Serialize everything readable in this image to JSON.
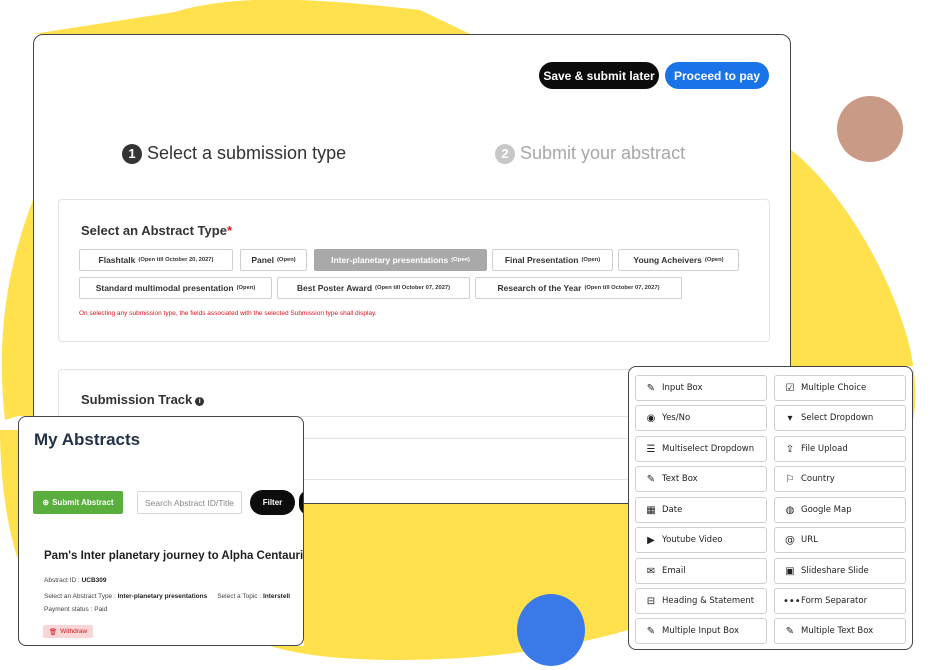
{
  "colors": {
    "yellow": "#ffe04d",
    "accent_blue": "#1a73e8",
    "dark": "#0c0c0c",
    "green": "#5aae3e",
    "error": "#d9141c"
  },
  "header": {
    "save_label": "Save & submit later",
    "proceed_label": "Proceed to pay"
  },
  "steps": [
    {
      "num": "1",
      "label": "Select a submission type"
    },
    {
      "num": "2",
      "label": "Submit your abstract"
    }
  ],
  "abstract_type": {
    "title": "Select an Abstract Type",
    "required_mark": "*",
    "options": [
      {
        "label": "Flashtalk",
        "status": "(Open till October 20, 2027)"
      },
      {
        "label": "Panel",
        "status": "(Open)"
      },
      {
        "label": "Inter-planetary presentations",
        "status": "(Open)"
      },
      {
        "label": "Final Presentation",
        "status": "(Open)"
      },
      {
        "label": "Young Acheivers",
        "status": "(Open)"
      },
      {
        "label": "Standard multimodal presentation",
        "status": "(Open)"
      },
      {
        "label": "Best Poster Award",
        "status": "(Open till October 07, 2027)"
      },
      {
        "label": "Research of the Year",
        "status": "(Open till October 07, 2027)"
      }
    ],
    "selected": "Inter-planetary presentations",
    "warning": "On selecting any submission type, the fields associated with the selected Submission type shall display."
  },
  "track": {
    "title": "Submission Track",
    "info_icon": "i"
  },
  "my_abstracts": {
    "title": "My Abstracts",
    "submit_label": "Submit Abstract",
    "search_placeholder": "Search Abstract ID/Title",
    "filter_label": "Filter",
    "item": {
      "title": "Pam's Inter planetary journey to Alpha Centauri",
      "id_label": "Abstract ID :",
      "id_value": "UCB309",
      "type_label": "Select an Abstract Type :",
      "type_value": "Inter-planetary presentations",
      "topic_label": "Select a Topic :",
      "topic_value": "Interstell",
      "payment_label": "Payment status :",
      "payment_value": "Paid",
      "withdraw_label": "Withdraw"
    }
  },
  "field_types": [
    {
      "label": "Input Box",
      "icon": "edit-icon"
    },
    {
      "label": "Multiple Choice",
      "icon": "checkbox-icon"
    },
    {
      "label": "Yes/No",
      "icon": "radio-icon"
    },
    {
      "label": "Select Dropdown",
      "icon": "caret-down-icon"
    },
    {
      "label": "Multiselect Dropdown",
      "icon": "list-icon"
    },
    {
      "label": "File Upload",
      "icon": "upload-icon"
    },
    {
      "label": "Text Box",
      "icon": "edit-icon"
    },
    {
      "label": "Country",
      "icon": "flag-icon"
    },
    {
      "label": "Date",
      "icon": "calendar-icon"
    },
    {
      "label": "Google Map",
      "icon": "globe-icon"
    },
    {
      "label": "Youtube Video",
      "icon": "youtube-icon"
    },
    {
      "label": "URL",
      "icon": "at-icon"
    },
    {
      "label": "Email",
      "icon": "envelope-icon"
    },
    {
      "label": "Slideshare Slide",
      "icon": "slideshare-icon"
    },
    {
      "label": "Heading & Statement",
      "icon": "heading-icon"
    },
    {
      "label": "Form Separator",
      "icon": "ellipsis-icon"
    },
    {
      "label": "Multiple Input Box",
      "icon": "edit-icon"
    },
    {
      "label": "Multiple Text Box",
      "icon": "edit-icon"
    }
  ]
}
